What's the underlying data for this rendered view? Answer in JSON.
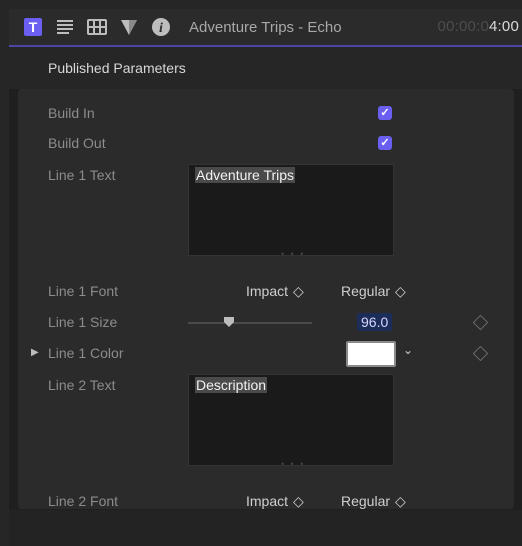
{
  "titlebar": {
    "tabs": [
      {
        "name": "text-inspector",
        "icon": "text-tab-icon",
        "selected": true
      },
      {
        "name": "paragraph-inspector",
        "icon": "paragraph-icon",
        "selected": false
      },
      {
        "name": "video-inspector",
        "icon": "film-icon",
        "selected": false
      },
      {
        "name": "color-inspector",
        "icon": "color-board-icon",
        "selected": false
      },
      {
        "name": "info-inspector",
        "icon": "info-icon",
        "selected": false
      }
    ],
    "title": "Adventure Trips - Echo",
    "timecode_dim": "00:00:0",
    "timecode_lit": "4:00"
  },
  "section": {
    "title": "Published Parameters"
  },
  "params": {
    "build_in": {
      "label": "Build In",
      "checked": true,
      "check_glyph": "✓"
    },
    "build_out": {
      "label": "Build Out",
      "checked": true,
      "check_glyph": "✓"
    },
    "line1_text": {
      "label": "Line 1 Text",
      "value": "Adventure Trips"
    },
    "line1_font": {
      "label": "Line 1 Font",
      "family": "Impact",
      "style": "Regular"
    },
    "line1_size": {
      "label": "Line 1 Size",
      "value": "96.0",
      "slider_fraction": 0.33
    },
    "line1_color": {
      "label": "Line 1 Color",
      "color": "#ffffff"
    },
    "line2_text": {
      "label": "Line 2 Text",
      "value": "Description"
    },
    "line2_font": {
      "label": "Line 2 Font",
      "family": "Impact",
      "style": "Regular"
    }
  },
  "glyphs": {
    "popup_chevron": "◇",
    "disclosure": "▶",
    "dropdown": "⌄",
    "grip": "• • •"
  },
  "colors": {
    "accent": "#6a5ff0",
    "tab_underline": "#4a47a8"
  }
}
